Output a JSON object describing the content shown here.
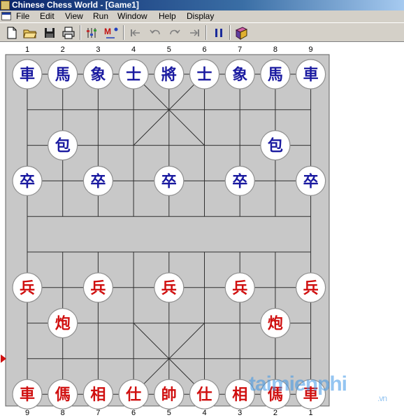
{
  "window": {
    "title": "Chinese Chess World - [Game1]"
  },
  "menu": [
    "File",
    "Edit",
    "View",
    "Run",
    "Window",
    "Help",
    "Display"
  ],
  "toolbar": [
    {
      "name": "new-icon"
    },
    {
      "name": "open-folder-icon"
    },
    {
      "name": "save-icon"
    },
    {
      "name": "print-icon"
    },
    {
      "name": "settings-icon"
    },
    {
      "name": "move-icon",
      "label": "M"
    },
    {
      "name": "first-move-icon"
    },
    {
      "name": "undo-icon"
    },
    {
      "name": "redo-icon"
    },
    {
      "name": "last-move-icon"
    },
    {
      "name": "pause-icon"
    },
    {
      "name": "book-icon"
    }
  ],
  "board": {
    "top_labels": [
      "1",
      "2",
      "3",
      "4",
      "5",
      "6",
      "7",
      "8",
      "9"
    ],
    "bottom_labels": [
      "9",
      "8",
      "7",
      "6",
      "5",
      "4",
      "3",
      "2",
      "1"
    ],
    "colors": {
      "board": "#c8c8c8",
      "black_side": "#1a1aa0",
      "red_side": "#d01010",
      "turn_marker": "#d01010"
    },
    "turn_marker_side": "red"
  },
  "pieces": [
    {
      "char": "車",
      "side": "black",
      "file": 1,
      "rank": 0
    },
    {
      "char": "馬",
      "side": "black",
      "file": 2,
      "rank": 0
    },
    {
      "char": "象",
      "side": "black",
      "file": 3,
      "rank": 0
    },
    {
      "char": "士",
      "side": "black",
      "file": 4,
      "rank": 0
    },
    {
      "char": "將",
      "side": "black",
      "file": 5,
      "rank": 0
    },
    {
      "char": "士",
      "side": "black",
      "file": 6,
      "rank": 0
    },
    {
      "char": "象",
      "side": "black",
      "file": 7,
      "rank": 0
    },
    {
      "char": "馬",
      "side": "black",
      "file": 8,
      "rank": 0
    },
    {
      "char": "車",
      "side": "black",
      "file": 9,
      "rank": 0
    },
    {
      "char": "包",
      "side": "black",
      "file": 2,
      "rank": 2
    },
    {
      "char": "包",
      "side": "black",
      "file": 8,
      "rank": 2
    },
    {
      "char": "卒",
      "side": "black",
      "file": 1,
      "rank": 3
    },
    {
      "char": "卒",
      "side": "black",
      "file": 3,
      "rank": 3
    },
    {
      "char": "卒",
      "side": "black",
      "file": 5,
      "rank": 3
    },
    {
      "char": "卒",
      "side": "black",
      "file": 7,
      "rank": 3
    },
    {
      "char": "卒",
      "side": "black",
      "file": 9,
      "rank": 3
    },
    {
      "char": "兵",
      "side": "red",
      "file": 1,
      "rank": 6
    },
    {
      "char": "兵",
      "side": "red",
      "file": 3,
      "rank": 6
    },
    {
      "char": "兵",
      "side": "red",
      "file": 5,
      "rank": 6
    },
    {
      "char": "兵",
      "side": "red",
      "file": 7,
      "rank": 6
    },
    {
      "char": "兵",
      "side": "red",
      "file": 9,
      "rank": 6
    },
    {
      "char": "炮",
      "side": "red",
      "file": 2,
      "rank": 7
    },
    {
      "char": "炮",
      "side": "red",
      "file": 8,
      "rank": 7
    },
    {
      "char": "車",
      "side": "red",
      "file": 1,
      "rank": 9
    },
    {
      "char": "傌",
      "side": "red",
      "file": 2,
      "rank": 9
    },
    {
      "char": "相",
      "side": "red",
      "file": 3,
      "rank": 9
    },
    {
      "char": "仕",
      "side": "red",
      "file": 4,
      "rank": 9
    },
    {
      "char": "帥",
      "side": "red",
      "file": 5,
      "rank": 9
    },
    {
      "char": "仕",
      "side": "red",
      "file": 6,
      "rank": 9
    },
    {
      "char": "相",
      "side": "red",
      "file": 7,
      "rank": 9
    },
    {
      "char": "傌",
      "side": "red",
      "file": 8,
      "rank": 9
    },
    {
      "char": "車",
      "side": "red",
      "file": 9,
      "rank": 9
    }
  ],
  "watermark": {
    "main": "taimienphi",
    "sub": ".vn"
  }
}
